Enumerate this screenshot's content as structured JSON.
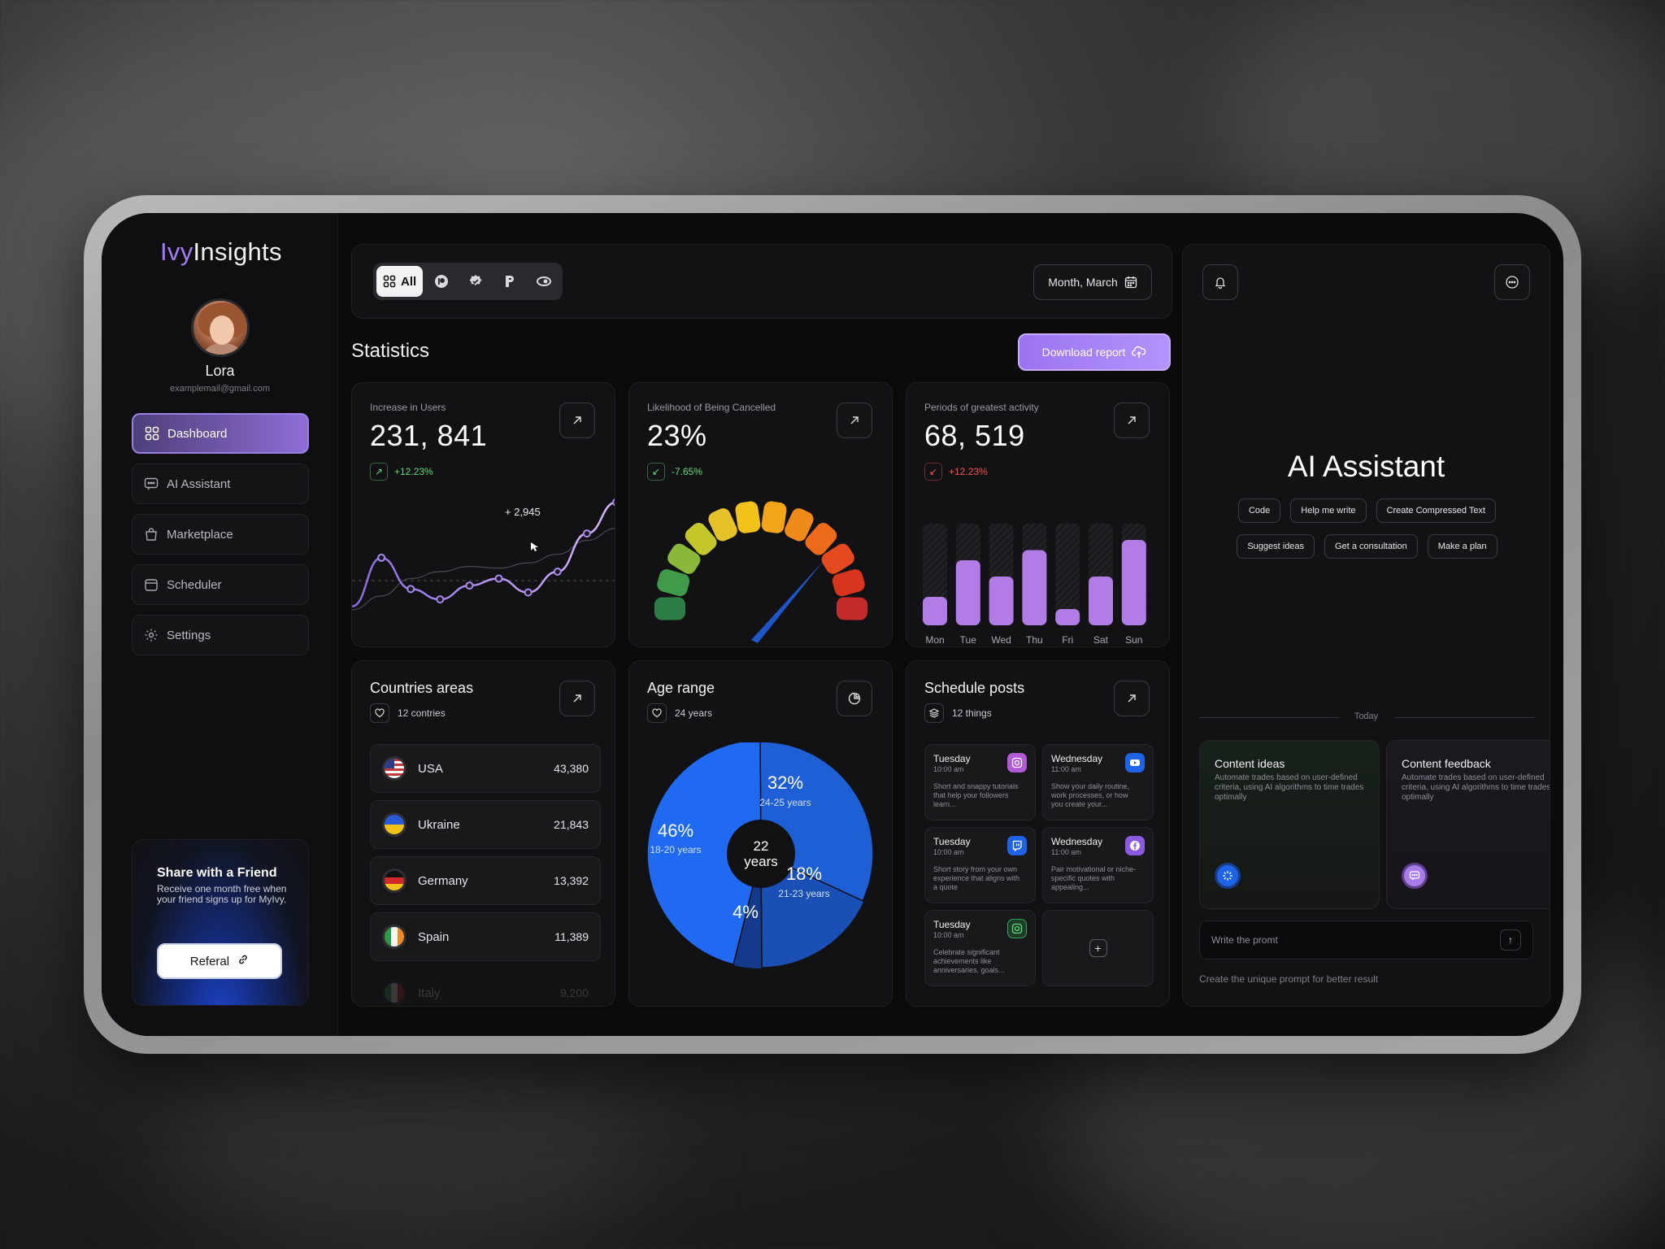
{
  "app": {
    "logo_prefix": "Ivy",
    "logo_suffix": "Insights"
  },
  "user": {
    "name": "Lora",
    "email": "examplemail@gmail.com"
  },
  "sidebar": {
    "items": [
      {
        "label": "Dashboard",
        "icon": "grid-icon",
        "active": true
      },
      {
        "label": "AI Assistant",
        "icon": "chat-icon",
        "active": false
      },
      {
        "label": "Marketplace",
        "icon": "bag-icon",
        "active": false
      },
      {
        "label": "Scheduler",
        "icon": "calendar-icon",
        "active": false
      },
      {
        "label": "Settings",
        "icon": "gear-icon",
        "active": false
      }
    ],
    "share": {
      "title": "Share with a Friend",
      "text": "Receive one month free when your friend signs up for MyIvy.",
      "button": "Referal"
    }
  },
  "topbar": {
    "filter_all": "All",
    "filter_icons": [
      "patreon-icon",
      "verified-icon",
      "producthunt-icon",
      "link-icon"
    ],
    "date": "Month, March"
  },
  "statistics": {
    "title": "Statistics",
    "download": "Download report"
  },
  "cards": {
    "users": {
      "label": "Increase in Users",
      "value": "231, 841",
      "delta": "+12.23%",
      "trend": "up",
      "annotation": "+ 2,945"
    },
    "cancel": {
      "label": "Likelihood of Being Cancelled",
      "value": "23%",
      "delta": "-7.65%",
      "trend": "down",
      "gauge_level": 0.77
    },
    "activity": {
      "label": "Periods of greatest activity",
      "value": "68, 519",
      "delta": "+12.23%",
      "trend": "down"
    }
  },
  "chart_data": [
    {
      "type": "line",
      "title": "Increase in Users",
      "series": [
        {
          "values": [
            10,
            38,
            20,
            14,
            22,
            26,
            18,
            30,
            52,
            70
          ]
        },
        {
          "values": [
            8,
            16,
            26,
            30,
            33,
            32,
            35,
            40,
            48,
            55
          ]
        }
      ]
    },
    {
      "type": "bar",
      "title": "Periods of greatest activity",
      "categories": [
        "Mon",
        "Tue",
        "Wed",
        "Thu",
        "Fri",
        "Sat",
        "Sun"
      ],
      "values": [
        28,
        64,
        48,
        74,
        16,
        48,
        84
      ],
      "ylim": [
        0,
        100
      ]
    },
    {
      "type": "pie",
      "title": "Age range",
      "slices": [
        {
          "label": "24-25 years",
          "value": 32,
          "color": "#1f5fd6"
        },
        {
          "label": "21-23 years",
          "value": 18,
          "color": "#1a4fb5"
        },
        {
          "label": "",
          "value": 4,
          "color": "#153a8c"
        },
        {
          "label": "18-20 years",
          "value": 46,
          "color": "#1f6af0"
        }
      ],
      "center": "22 years"
    }
  ],
  "countries": {
    "title": "Countries areas",
    "count": "12 contries",
    "rows": [
      {
        "name": "USA",
        "value": "43,380"
      },
      {
        "name": "Ukraine",
        "value": "21,843"
      },
      {
        "name": "Germany",
        "value": "13,392"
      },
      {
        "name": "Spain",
        "value": "11,389"
      },
      {
        "name": "Italy",
        "value": "9,200"
      }
    ]
  },
  "age": {
    "title": "Age range",
    "sub": "24 years",
    "center_top": "22",
    "center_bottom": "years",
    "p32": "32%",
    "l32": "24-25 years",
    "p46": "46%",
    "l46": "18-20 years",
    "p18": "18%",
    "l18": "21-23 years",
    "p4": "4%"
  },
  "schedule": {
    "title": "Schedule posts",
    "count": "12 things",
    "posts": [
      {
        "day": "Tuesday",
        "time": "10:00 am",
        "desc": "Short and snappy tutorials that help your followers learn...",
        "icon": "instagram-icon",
        "color": "#b15cd6"
      },
      {
        "day": "Wednesday",
        "time": "11:00 am",
        "desc": "Show your daily routine, work processes, or how you create your...",
        "icon": "youtube-icon",
        "color": "#1e63e6"
      },
      {
        "day": "Tuesday",
        "time": "10:00 am",
        "desc": "Short story from your own experience that aligns with a quote",
        "icon": "twitch-icon",
        "color": "#1e63e6"
      },
      {
        "day": "Wednesday",
        "time": "11:00 am",
        "desc": "Pair motivational or niche-specific quotes with appealing...",
        "icon": "facebook-icon",
        "color": "#8a5ae0"
      },
      {
        "day": "Tuesday",
        "time": "10:00 am",
        "desc": "Celebrate significant achievements like anniversaries, goals...",
        "icon": "instagram-icon",
        "color": "#2fa55a"
      }
    ]
  },
  "assistant": {
    "title": "AI Assistant",
    "chips": [
      "Code",
      "Help me write",
      "Create Compressed Text",
      "Suggest ideas",
      "Get a consultation",
      "Make a plan"
    ],
    "today": "Today",
    "feed": [
      {
        "title": "Content ideas",
        "text": "Automate trades based on user-defined criteria, using AI algorithms to time trades optimally"
      },
      {
        "title": "Content feedback",
        "text": "Automate trades based on user-defined criteria, using AI algorithms to time trades optimally"
      }
    ],
    "prompt_placeholder": "Write the promt",
    "prompt_hint": "Create the unique prompt for better result"
  }
}
